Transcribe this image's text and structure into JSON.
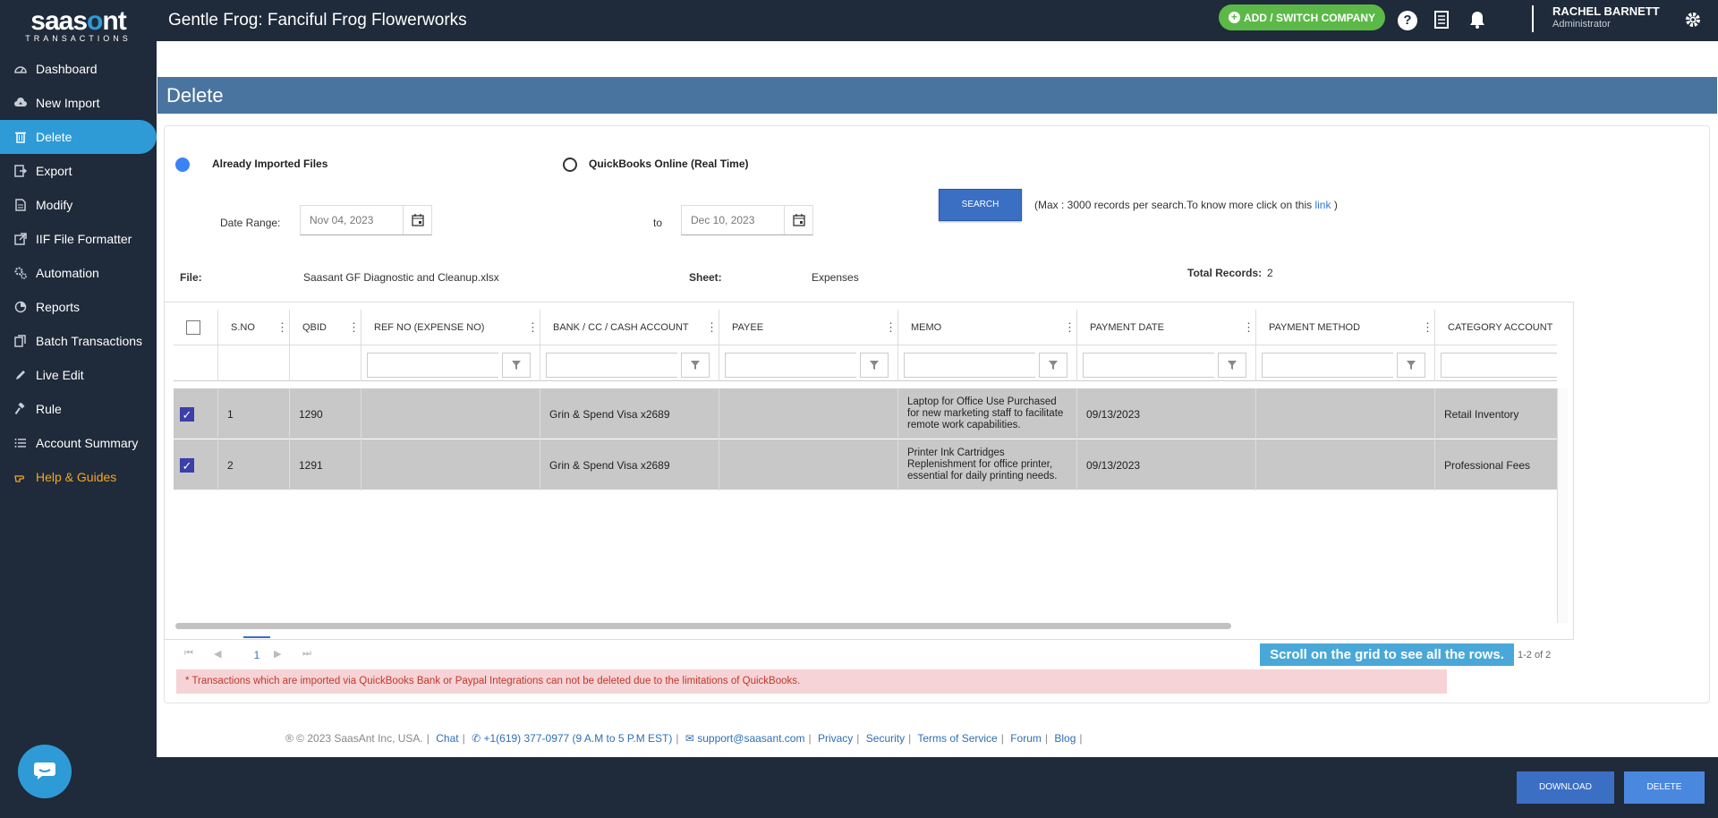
{
  "logo": {
    "brand_pre": "saas",
    "brand_o": "o",
    "brand_post": "nt",
    "sub": "TRANSACTIONS"
  },
  "sidebar": {
    "items": [
      {
        "label": "Dashboard",
        "icon": "dashboard-icon"
      },
      {
        "label": "New Import",
        "icon": "cloud-upload-icon"
      },
      {
        "label": "Delete",
        "icon": "trash-icon",
        "active": true
      },
      {
        "label": "Export",
        "icon": "export-icon"
      },
      {
        "label": "Modify",
        "icon": "file-edit-icon"
      },
      {
        "label": "IIF File Formatter",
        "icon": "external-link-icon"
      },
      {
        "label": "Automation",
        "icon": "cogs-icon"
      },
      {
        "label": "Reports",
        "icon": "reports-icon"
      },
      {
        "label": "Batch Transactions",
        "icon": "copy-icon"
      },
      {
        "label": "Live Edit",
        "icon": "pencil-icon"
      },
      {
        "label": "Rule",
        "icon": "gavel-icon"
      },
      {
        "label": "Account Summary",
        "icon": "list-icon"
      },
      {
        "label": "Help & Guides",
        "icon": "hand-point-icon"
      }
    ]
  },
  "header": {
    "company_title": "Gentle Frog: Fanciful Frog Flowerworks",
    "add_company_label": "ADD / SWITCH COMPANY",
    "user_name": "RACHEL BARNETT",
    "user_role": "Administrator"
  },
  "page": {
    "title": "Delete"
  },
  "source": {
    "option1": "Already Imported Files",
    "option2": "QuickBooks Online (Real Time)",
    "search_label": "SEARCH",
    "note_pre": "(Max : 3000 records per search.To know more click on this",
    "note_link": "link",
    "note_post": ")"
  },
  "filters": {
    "date_range_label": "Date Range:",
    "from_date": "Nov 04, 2023",
    "to_label": "to",
    "to_date": "Dec 10, 2023"
  },
  "file_info": {
    "file_label": "File:",
    "file_value": "Saasant GF Diagnostic and Cleanup.xlsx",
    "sheet_label": "Sheet:",
    "sheet_value": "Expenses",
    "total_label": "Total Records:",
    "total_value": "2"
  },
  "grid": {
    "columns": [
      "S.NO",
      "QBID",
      "REF NO (EXPENSE NO)",
      "BANK / CC / CASH ACCOUNT",
      "PAYEE",
      "MEMO",
      "PAYMENT DATE",
      "PAYMENT METHOD",
      "CATEGORY ACCOUNT"
    ],
    "rows": [
      {
        "checked": true,
        "sno": "1",
        "qbid": "1290",
        "ref": "",
        "bank": "Grin & Spend Visa x2689",
        "payee": "",
        "memo": "Laptop for Office Use Purchased for new marketing staff to facilitate remote work capabilities.",
        "date": "09/13/2023",
        "method": "",
        "category": "Retail Inventory"
      },
      {
        "checked": true,
        "sno": "2",
        "qbid": "1291",
        "ref": "",
        "bank": "Grin & Spend Visa x2689",
        "payee": "",
        "memo": "Printer Ink Cartridges Replenishment for office printer, essential for daily printing needs.",
        "date": "09/13/2023",
        "method": "",
        "category": "Professional Fees"
      }
    ]
  },
  "pager": {
    "page": "1",
    "hint": "Scroll on the grid to see all the rows.",
    "count": "1-2 of 2"
  },
  "warning": "* Transactions which are imported via QuickBooks Bank or Paypal Integrations can not be deleted due to the limitations of QuickBooks.",
  "footer": {
    "copyright": "® © 2023 SaasAnt Inc, USA.",
    "chat": "Chat",
    "phone": "+1(619) 377-0977 (9 A.M to 5 P.M EST)",
    "email": "support@saasant.com",
    "privacy": "Privacy",
    "security": "Security",
    "terms": "Terms of Service",
    "forum": "Forum",
    "blog": "Blog"
  },
  "actions": {
    "download": "DOWNLOAD",
    "delete": "DELETE"
  },
  "colors": {
    "accent": "#2e9bd6",
    "sidebar_bg": "#1f2a3a",
    "page_header": "#4a74a0",
    "green": "#5cb947",
    "help_orange": "#f6a623"
  }
}
